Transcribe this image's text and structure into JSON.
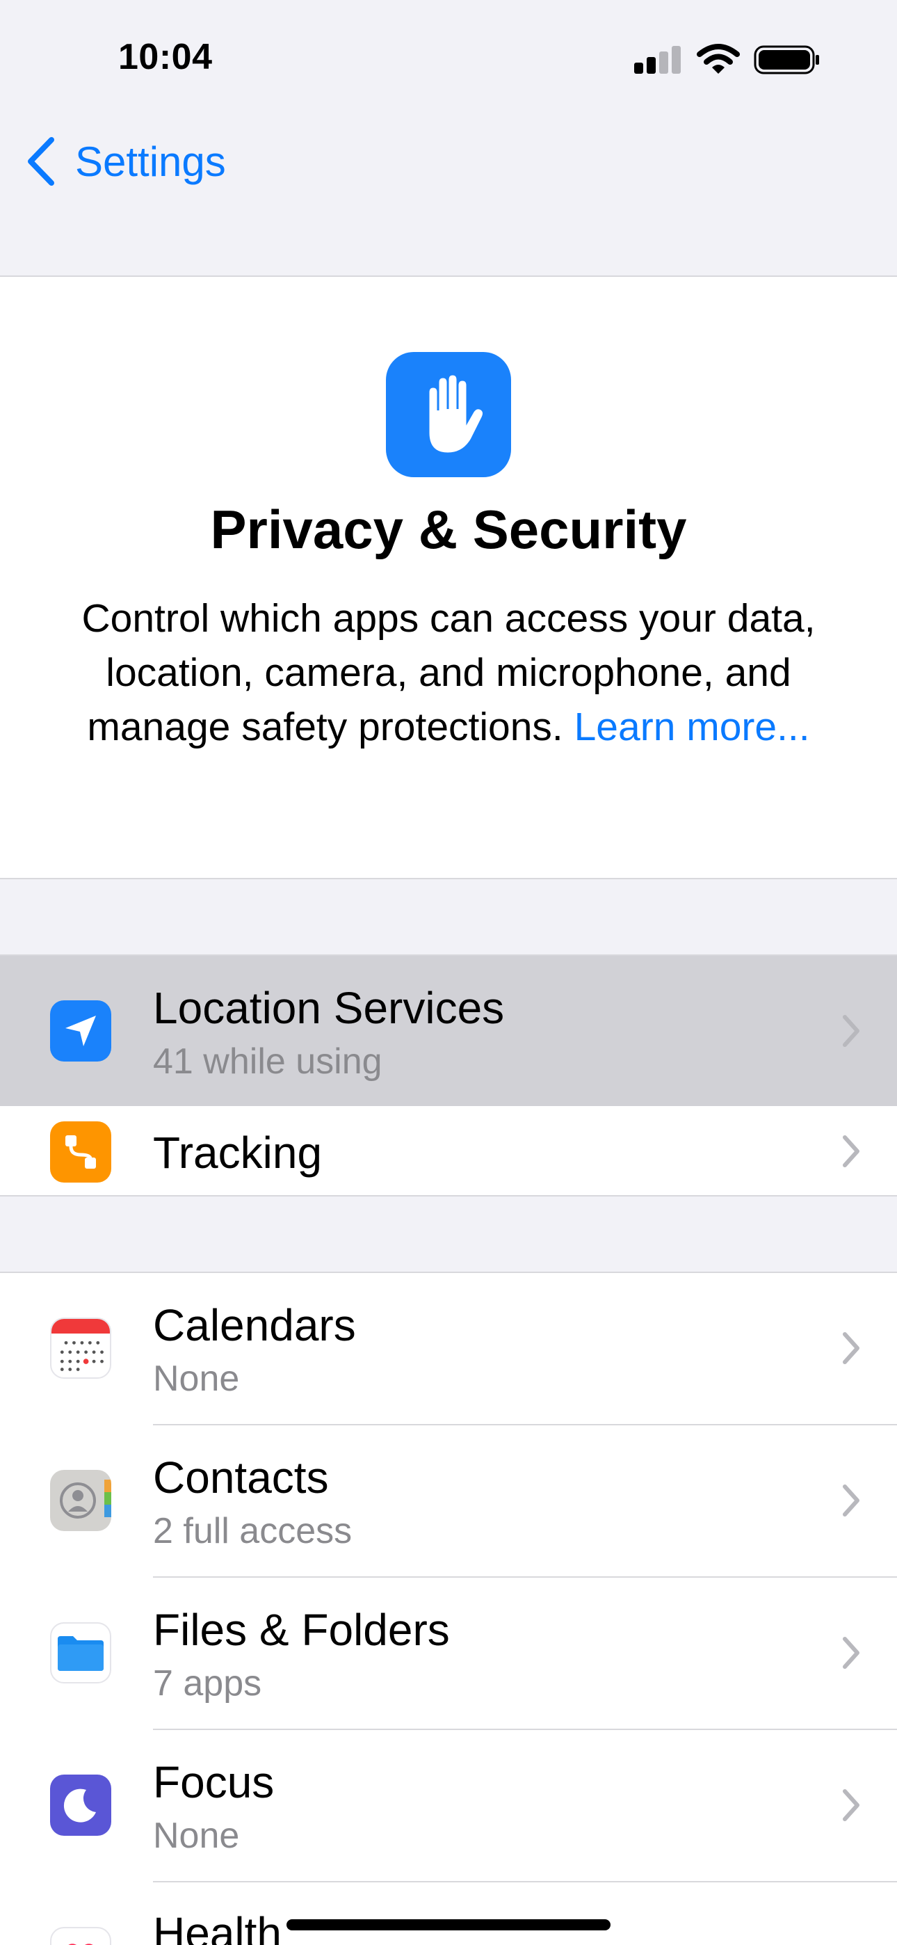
{
  "status_bar": {
    "time": "10:04",
    "signal_bars_active": 2,
    "signal_bars_total": 4
  },
  "nav": {
    "back_label": "Settings"
  },
  "hero": {
    "title": "Privacy & Security",
    "description": "Control which apps can access your data, location, camera, and microphone, and manage safety protections.",
    "link": "Learn more..."
  },
  "groups": [
    {
      "rows": [
        {
          "title": "Location Services",
          "subtitle": "41 while using",
          "icon": "location-arrow-icon",
          "color": "#1a82fb",
          "highlighted": true
        },
        {
          "title": "Tracking",
          "subtitle": "",
          "icon": "tracking-icon",
          "color": "#fe9500",
          "highlighted": false
        }
      ]
    },
    {
      "rows": [
        {
          "title": "Calendars",
          "subtitle": "None",
          "icon": "calendar-icon"
        },
        {
          "title": "Contacts",
          "subtitle": "2 full access",
          "icon": "contacts-icon"
        },
        {
          "title": "Files & Folders",
          "subtitle": "7 apps",
          "icon": "folder-icon",
          "color": "#1a8cf0"
        },
        {
          "title": "Focus",
          "subtitle": "None",
          "icon": "moon-icon",
          "color": "#5a56d6"
        },
        {
          "title": "Health",
          "subtitle": "",
          "icon": "heart-icon",
          "color": "#ff2d55"
        }
      ]
    }
  ]
}
